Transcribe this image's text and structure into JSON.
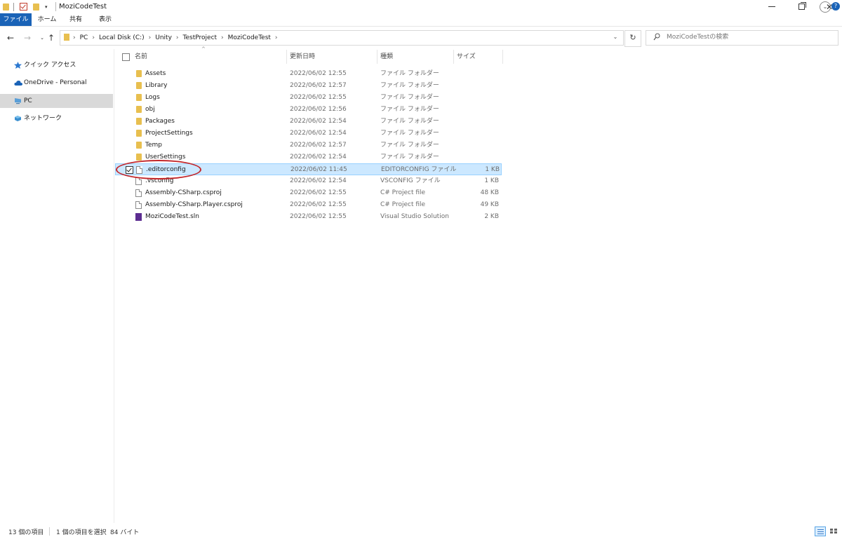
{
  "window": {
    "title": "MoziCodeTest",
    "qat_dropdown": "▾",
    "minimize": "—",
    "close": "✕"
  },
  "ribbon": {
    "tabs": [
      "ファイル",
      "ホーム",
      "共有",
      "表示"
    ],
    "expand": "⌄",
    "help": "?"
  },
  "nav": {
    "back": "←",
    "forward": "→",
    "recent": "⌄",
    "up": "↑",
    "breadcrumb": [
      "PC",
      "Local Disk (C:)",
      "Unity",
      "TestProject",
      "MoziCodeTest"
    ],
    "separator": "›",
    "dropdown": "⌄",
    "refresh": "↻"
  },
  "search": {
    "placeholder": "MoziCodeTestの検索"
  },
  "sidebar": {
    "items": [
      {
        "label": "クイック アクセス",
        "icon": "star-icon"
      },
      {
        "label": "OneDrive - Personal",
        "icon": "cloud-icon"
      },
      {
        "label": "PC",
        "icon": "computer-icon"
      },
      {
        "label": "ネットワーク",
        "icon": "network-icon"
      }
    ]
  },
  "columns": {
    "name": "名前",
    "date": "更新日時",
    "type": "種類",
    "size": "サイズ",
    "sort_arrow": "^"
  },
  "files": [
    {
      "name": "Assets",
      "date": "2022/06/02 12:55",
      "type": "ファイル フォルダー",
      "size": "",
      "kind": "folder"
    },
    {
      "name": "Library",
      "date": "2022/06/02 12:57",
      "type": "ファイル フォルダー",
      "size": "",
      "kind": "folder"
    },
    {
      "name": "Logs",
      "date": "2022/06/02 12:55",
      "type": "ファイル フォルダー",
      "size": "",
      "kind": "folder"
    },
    {
      "name": "obj",
      "date": "2022/06/02 12:56",
      "type": "ファイル フォルダー",
      "size": "",
      "kind": "folder"
    },
    {
      "name": "Packages",
      "date": "2022/06/02 12:54",
      "type": "ファイル フォルダー",
      "size": "",
      "kind": "folder"
    },
    {
      "name": "ProjectSettings",
      "date": "2022/06/02 12:54",
      "type": "ファイル フォルダー",
      "size": "",
      "kind": "folder"
    },
    {
      "name": "Temp",
      "date": "2022/06/02 12:57",
      "type": "ファイル フォルダー",
      "size": "",
      "kind": "folder"
    },
    {
      "name": "UserSettings",
      "date": "2022/06/02 12:54",
      "type": "ファイル フォルダー",
      "size": "",
      "kind": "folder"
    },
    {
      "name": ".editorconfig",
      "date": "2022/06/02 11:45",
      "type": "EDITORCONFIG ファイル",
      "size": "1 KB",
      "kind": "file",
      "selected": true
    },
    {
      "name": ".vsconfig",
      "date": "2022/06/02 12:54",
      "type": "VSCONFIG ファイル",
      "size": "1 KB",
      "kind": "file"
    },
    {
      "name": "Assembly-CSharp.csproj",
      "date": "2022/06/02 12:55",
      "type": "C# Project file",
      "size": "48 KB",
      "kind": "file"
    },
    {
      "name": "Assembly-CSharp.Player.csproj",
      "date": "2022/06/02 12:55",
      "type": "C# Project file",
      "size": "49 KB",
      "kind": "file"
    },
    {
      "name": "MoziCodeTest.sln",
      "date": "2022/06/02 12:55",
      "type": "Visual Studio Solution",
      "size": "2 KB",
      "kind": "sln"
    }
  ],
  "status": {
    "count": "13 個の項目",
    "selected": "1 個の項目を選択",
    "size": "84 バイト"
  },
  "colors": {
    "accent": "#1a63b7",
    "selection": "#cce8ff",
    "annotation": "#c3272b",
    "folder": "#e8bf4f"
  }
}
